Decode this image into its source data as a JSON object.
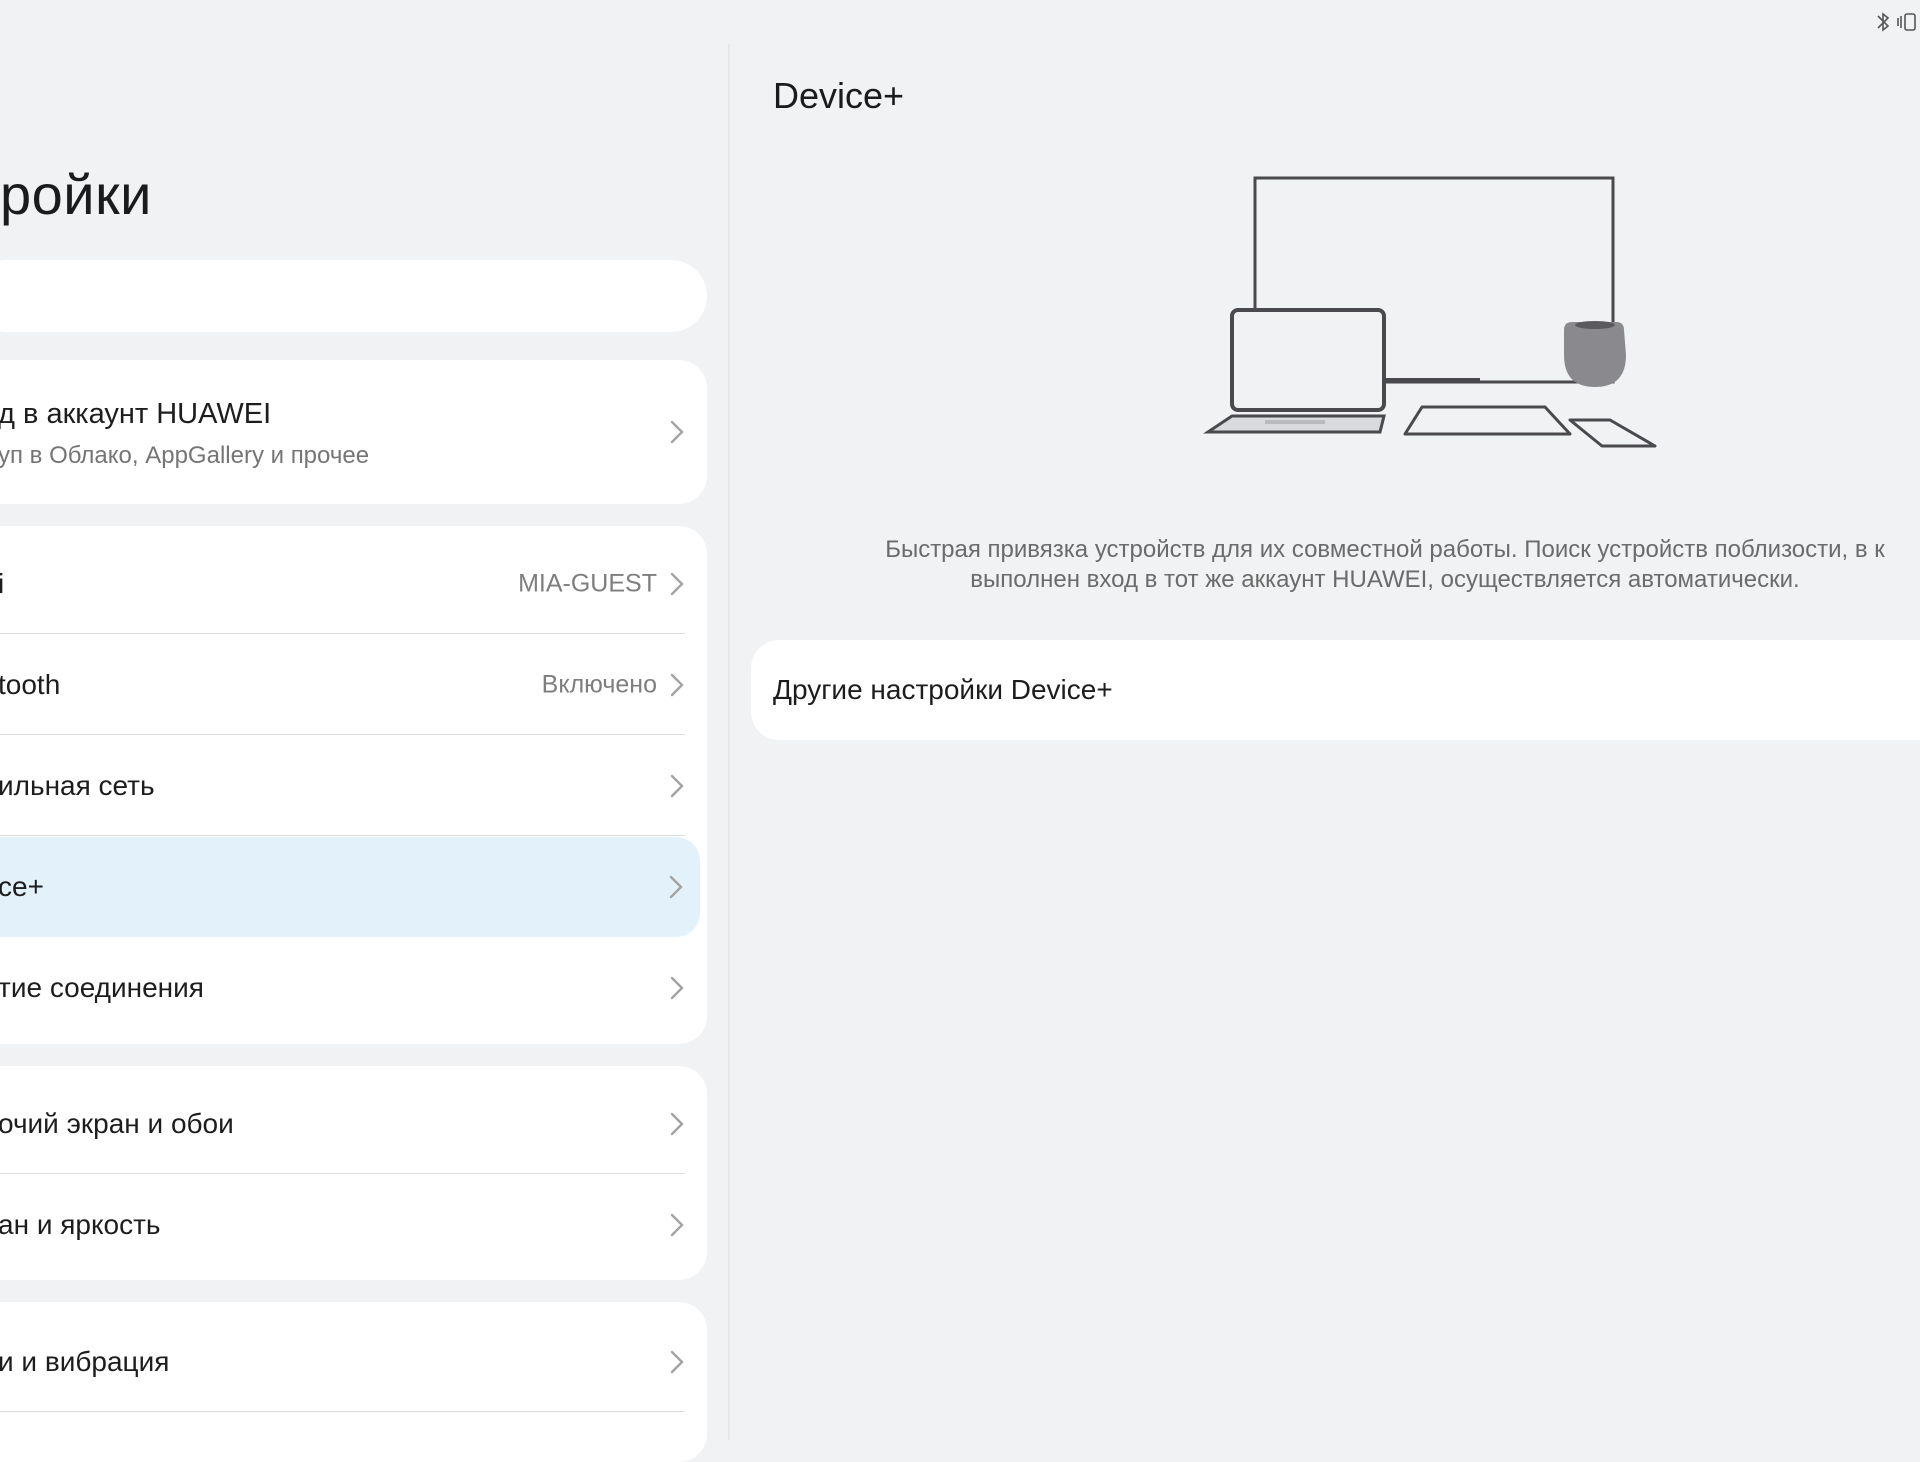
{
  "status_bar": {
    "icons": [
      "bluetooth-icon",
      "vibrate-icon"
    ]
  },
  "settings": {
    "title": "ройки",
    "account": {
      "title": "д в аккаунт HUAWEI",
      "subtitle": "уп в Облако, AppGallery и прочее"
    },
    "network_items": [
      {
        "label": "i",
        "value": "MIA-GUEST"
      },
      {
        "label": "tooth",
        "value": "Включено"
      },
      {
        "label": "ильная сеть",
        "value": ""
      },
      {
        "label": "ce+",
        "value": "",
        "selected": true
      },
      {
        "label": "тие соединения",
        "value": ""
      }
    ],
    "display_items": [
      {
        "label": "очий экран и обои"
      },
      {
        "label": "ан и яркость"
      }
    ],
    "sound_items": [
      {
        "label": "и и вибрация"
      }
    ]
  },
  "detail": {
    "title": "Device+",
    "description_line1": "Быстрая привязка устройств для их совместной работы. Поиск устройств поблизости, в к",
    "description_line2": "выполнен вход в тот же аккаунт HUAWEI, осуществляется автоматически.",
    "more_settings_label": "Другие настройки Device+"
  },
  "colors": {
    "background": "#f1f2f4",
    "card": "#ffffff",
    "selected_row": "#e3f1fb",
    "secondary_text": "#7e7e7e"
  }
}
